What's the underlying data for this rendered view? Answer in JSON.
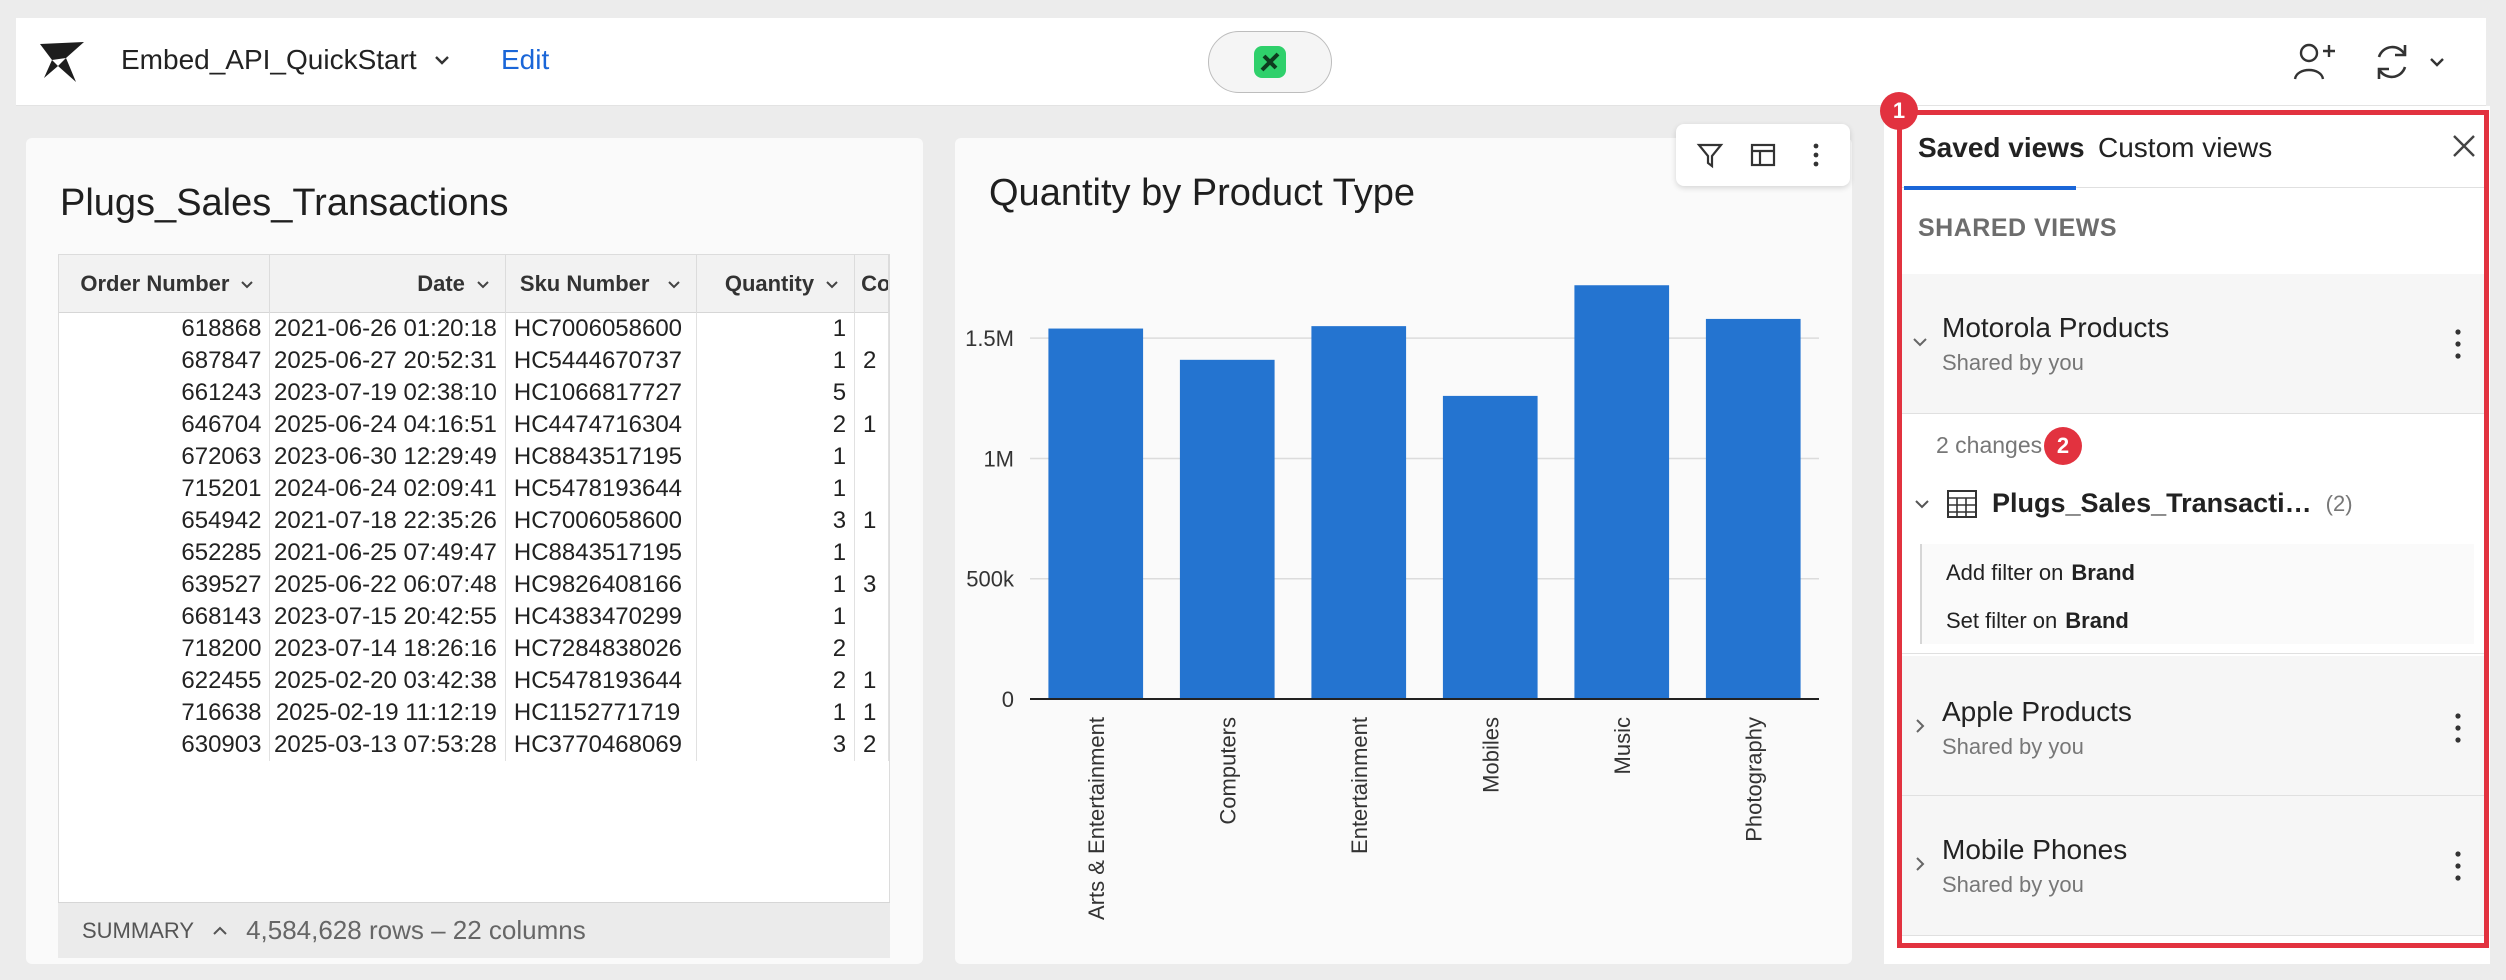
{
  "header": {
    "app_title": "Embed_API_QuickStart",
    "edit_label": "Edit"
  },
  "table_card": {
    "title": "Plugs_Sales_Transactions",
    "columns": [
      "Order Number",
      "Date",
      "Sku Number",
      "Quantity",
      "Co"
    ],
    "rows": [
      [
        "618868",
        "2021-06-26 01:20:18",
        "HC7006058600",
        "1",
        ""
      ],
      [
        "687847",
        "2025-06-27 20:52:31",
        "HC5444670737",
        "1",
        "2"
      ],
      [
        "661243",
        "2023-07-19 02:38:10",
        "HC1066817727",
        "5",
        ""
      ],
      [
        "646704",
        "2025-06-24 04:16:51",
        "HC4474716304",
        "2",
        "1"
      ],
      [
        "672063",
        "2023-06-30 12:29:49",
        "HC8843517195",
        "1",
        ""
      ],
      [
        "715201",
        "2024-06-24 02:09:41",
        "HC5478193644",
        "1",
        ""
      ],
      [
        "654942",
        "2021-07-18 22:35:26",
        "HC7006058600",
        "3",
        "1"
      ],
      [
        "652285",
        "2021-06-25 07:49:47",
        "HC8843517195",
        "1",
        ""
      ],
      [
        "639527",
        "2025-06-22 06:07:48",
        "HC9826408166",
        "1",
        "3"
      ],
      [
        "668143",
        "2023-07-15 20:42:55",
        "HC4383470299",
        "1",
        ""
      ],
      [
        "718200",
        "2023-07-14 18:26:16",
        "HC7284838026",
        "2",
        ""
      ],
      [
        "622455",
        "2025-02-20 03:42:38",
        "HC5478193644",
        "2",
        "1"
      ],
      [
        "716638",
        "2025-02-19 11:12:19",
        "HC1152771719",
        "1",
        "1"
      ],
      [
        "630903",
        "2025-03-13 07:53:28",
        "HC3770468069",
        "3",
        "2"
      ]
    ],
    "summary_label": "SUMMARY",
    "summary_count": "4,584,628 rows – 22 columns"
  },
  "chart_data": {
    "type": "bar",
    "title": "Quantity by Product Type",
    "categories": [
      "Arts & Entertainment",
      "Computers",
      "Entertainment",
      "Mobiles",
      "Music",
      "Photography"
    ],
    "values": [
      1540000,
      1410000,
      1550000,
      1260000,
      1720000,
      1580000
    ],
    "ylim": [
      0,
      1800000
    ],
    "yticks": [
      {
        "value": 0,
        "label": "0"
      },
      {
        "value": 500000,
        "label": "500k"
      },
      {
        "value": 1000000,
        "label": "1M"
      },
      {
        "value": 1500000,
        "label": "1.5M"
      }
    ],
    "bar_color": "#2474d0",
    "grid": true
  },
  "panel": {
    "tabs": [
      "Saved views",
      "Custom views"
    ],
    "section_label": "SHARED VIEWS",
    "views": [
      {
        "title": "Motorola Products",
        "subtitle": "Shared by you"
      },
      {
        "title": "Apple Products",
        "subtitle": "Shared by you"
      },
      {
        "title": "Mobile Phones",
        "subtitle": "Shared by you"
      }
    ],
    "changes_label": "2 changes",
    "changed_table": "Plugs_Sales_Transacti…",
    "changed_count": "(2)",
    "filters": [
      {
        "action": "Add filter on",
        "field": "Brand"
      },
      {
        "action": "Set filter on",
        "field": "Brand"
      }
    ],
    "badges": [
      "1",
      "2"
    ],
    "accent_color": "#1a66d8",
    "highlight_color": "#e2323f"
  }
}
